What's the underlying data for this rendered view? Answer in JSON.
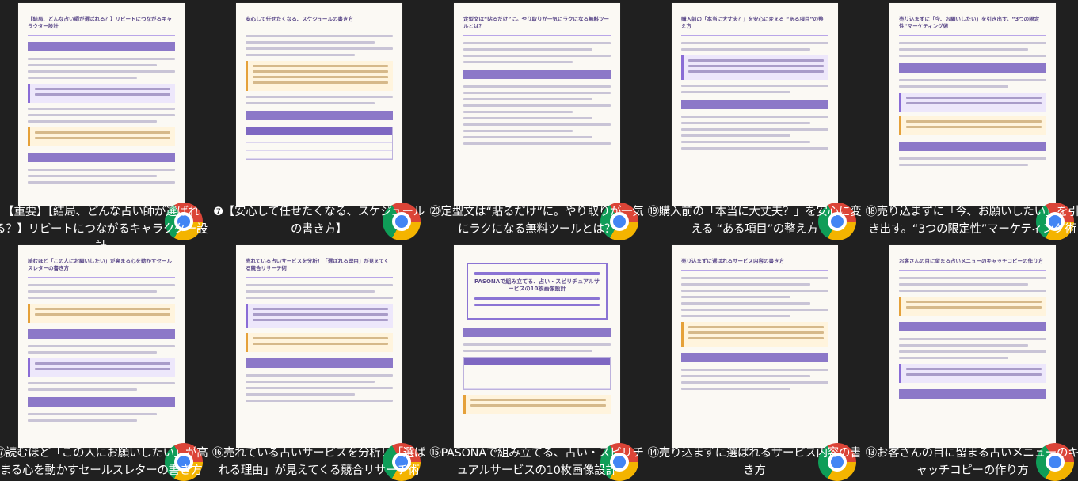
{
  "files": [
    {
      "caption": "【重要】【結局、どんな占い師が選ばれる？】リピートにつながるキャラクター設計",
      "thumb_title": "【結局、どんな占い師が選ばれる？】リピートにつながるキャラクター設計"
    },
    {
      "caption": "❼【安心して任せたくなる、スケジュールの書き方】",
      "thumb_title": "安心して任せたくなる、スケジュールの書き方"
    },
    {
      "caption": "⑳定型文は“貼るだけ”に。やり取りが一気にラクになる無料ツールとは？",
      "thumb_title": "定型文は“貼るだけ”に。やり取りが一気にラクになる無料ツールとは？"
    },
    {
      "caption": "⑲購入前の「本当に大丈夫？」を安心に変える “ある項目”の整え方",
      "thumb_title": "購入前の「本当に大丈夫？」を安心に変える “ある項目”の整え方"
    },
    {
      "caption": "⑱売り込まずに「今、お願いしたい」を引き出す。“3つの限定性”マーケティング術",
      "thumb_title": "売り込まずに「今、お願いしたい」を引き出す。“3つの限定性”マーケティング術"
    },
    {
      "caption": "⑰読むほど「この人にお願いしたい」が高まる心を動かすセールスレターの書き方",
      "thumb_title": "読むほど「この人にお願いしたい」が高まる心を動かすセールスレターの書き方"
    },
    {
      "caption": "⑯売れている占いサービスを分析！「選ばれる理由」が見えてくる競合リサーチ術",
      "thumb_title": "売れている占いサービスを分析！「選ばれる理由」が見えてくる競合リサーチ術"
    },
    {
      "caption": "⑮PASONAで組み立てる、占い・スピリチュアルサービスの10枚画像設計",
      "thumb_title": "PASONAで組み立てる、占い・スピリチュアルサービスの10枚画像設計"
    },
    {
      "caption": "⑭売り込まずに選ばれるサービス内容の書き方",
      "thumb_title": "売り込まずに選ばれるサービス内容の書き方"
    },
    {
      "caption": "⑬お客さんの目に留まる占いメニューのキャッチコピーの作り方",
      "thumb_title": "お客さんの目に留まる占いメニューのキャッチコピーの作り方"
    }
  ],
  "icons": {
    "browser": "chrome-icon"
  },
  "colors": {
    "background": "#202020",
    "accent": "#8b74d4"
  }
}
